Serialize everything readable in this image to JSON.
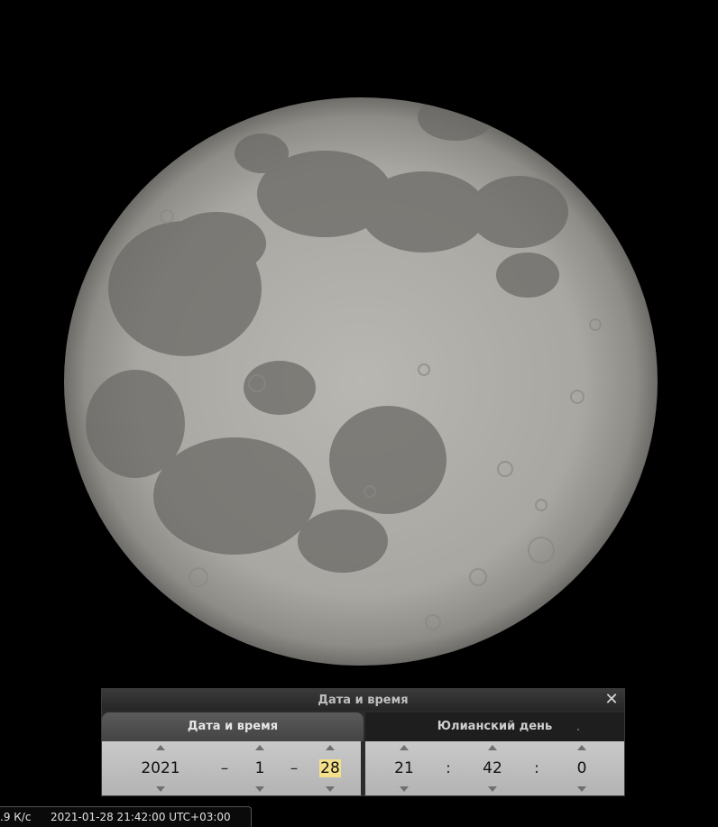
{
  "dialog": {
    "title": "Дата и время",
    "close_icon": "close-icon",
    "tabs": [
      {
        "label": "Дата и время",
        "active": true
      },
      {
        "label": "Юлианский день",
        "active": false
      }
    ],
    "date": {
      "year": "2021",
      "month": "1",
      "day": "28",
      "separator": "–"
    },
    "time": {
      "hour": "21",
      "minute": "42",
      "second": "0",
      "separator": ":"
    },
    "highlight_color": "#f4e08a"
  },
  "statusbar": {
    "fps": ".9 К/с",
    "datetime": "2021-01-28 21:42:00 UTC+03:00"
  }
}
